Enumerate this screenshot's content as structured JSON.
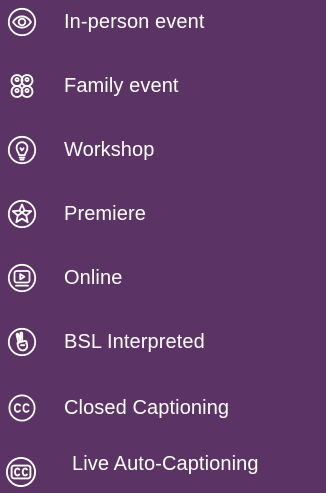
{
  "legend": {
    "items": [
      {
        "label": "In-person event",
        "icon": "eye-icon"
      },
      {
        "label": "Family event",
        "icon": "family-icon"
      },
      {
        "label": "Workshop",
        "icon": "lightbulb-icon"
      },
      {
        "label": "Premiere",
        "icon": "star-icon"
      },
      {
        "label": "Online",
        "icon": "play-screen-icon"
      },
      {
        "label": "BSL Interpreted",
        "icon": "signing-hand-icon"
      },
      {
        "label": "Closed Captioning",
        "icon": "closed-captions-icon"
      },
      {
        "label": "Live Auto-Captioning",
        "icon": "live-captions-icon"
      }
    ]
  },
  "colors": {
    "background": "#5b3364",
    "foreground": "#ffffff"
  }
}
